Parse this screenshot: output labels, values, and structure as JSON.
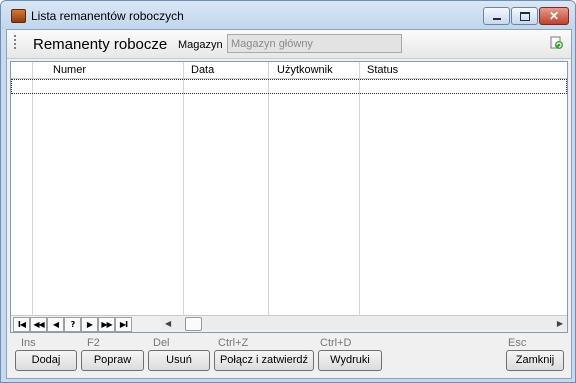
{
  "window": {
    "title": "Lista remanentów roboczych"
  },
  "toolbar": {
    "heading": "Remanenty robocze",
    "magazyn_label": "Magazyn",
    "magazyn_value": "Magazyn główny"
  },
  "grid": {
    "columns": [
      "",
      "Numer",
      "Data",
      "Użytkownik",
      "Status"
    ]
  },
  "navigator": {
    "buttons": [
      "I◀",
      "◀◀",
      "◀",
      "?",
      "▶",
      "▶▶",
      "▶I"
    ]
  },
  "actions": [
    {
      "shortcut": "Ins",
      "label": "Dodaj"
    },
    {
      "shortcut": "F2",
      "label": "Popraw"
    },
    {
      "shortcut": "Del",
      "label": "Usuń"
    },
    {
      "shortcut": "Ctrl+Z",
      "label": "Połącz i zatwierdź"
    },
    {
      "shortcut": "Ctrl+D",
      "label": "Wydruki"
    },
    {
      "shortcut": "Esc",
      "label": "Zamknij"
    }
  ],
  "icons": {
    "app": "inventory-box-icon",
    "refresh": "refresh-document-icon"
  }
}
